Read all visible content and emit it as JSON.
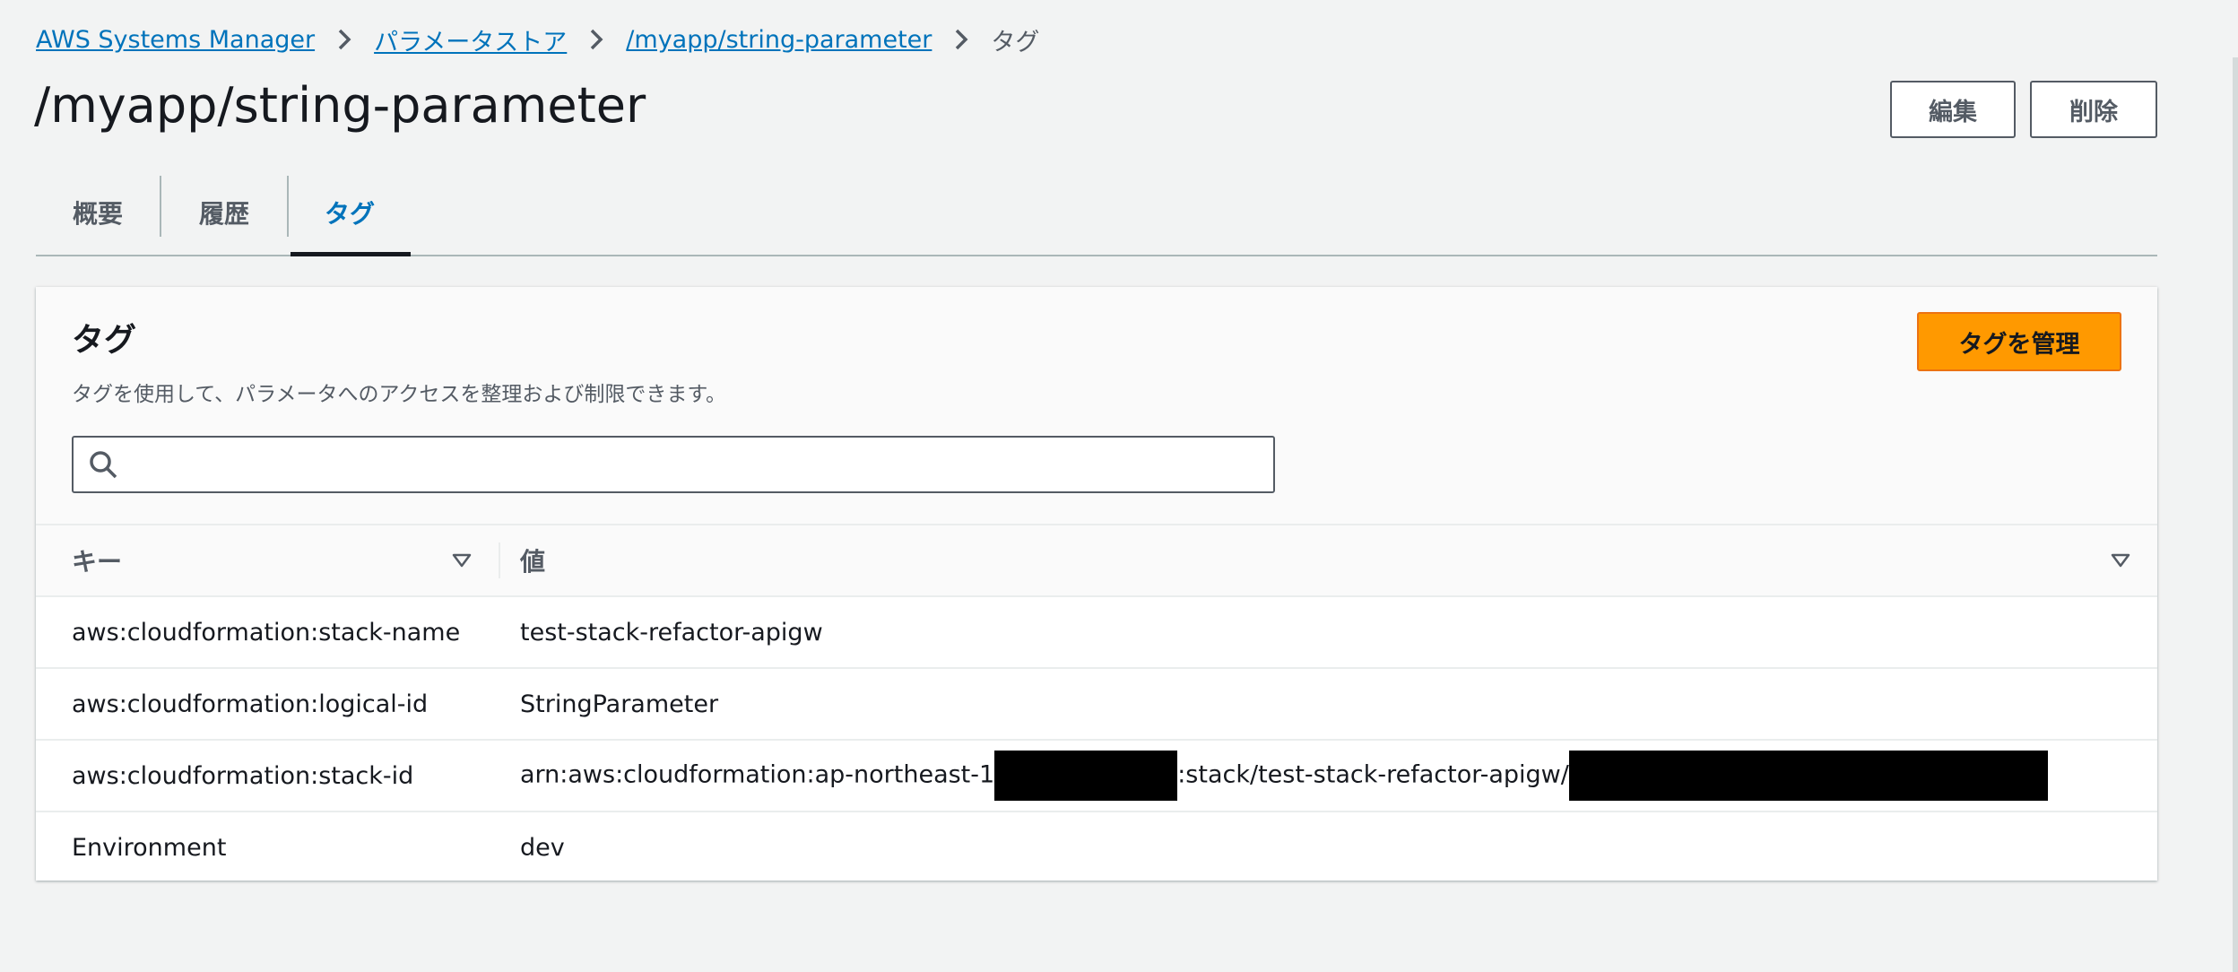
{
  "breadcrumb": {
    "items": [
      "AWS Systems Manager",
      "パラメータストア",
      "/myapp/string-parameter"
    ],
    "current": "タグ"
  },
  "page": {
    "title": "/myapp/string-parameter",
    "edit_label": "編集",
    "delete_label": "削除"
  },
  "tabs": [
    {
      "label": "概要",
      "active": false
    },
    {
      "label": "履歴",
      "active": false
    },
    {
      "label": "タグ",
      "active": true
    }
  ],
  "panel": {
    "title": "タグ",
    "description": "タグを使用して、パラメータへのアクセスを整理および制限できます。",
    "manage_button": "タグを管理",
    "search_placeholder": ""
  },
  "table": {
    "columns": [
      "キー",
      "値"
    ],
    "rows": [
      {
        "key": "aws:cloudformation:stack-name",
        "value": "test-stack-refactor-apigw"
      },
      {
        "key": "aws:cloudformation:logical-id",
        "value": "StringParameter"
      },
      {
        "key": "aws:cloudformation:stack-id",
        "value_parts": [
          "arn:aws:cloudformation:ap-northeast-1",
          ":stack/test-stack-refactor-apigw/"
        ]
      },
      {
        "key": "Environment",
        "value": "dev"
      }
    ]
  },
  "colors": {
    "link": "#0073bb",
    "primary": "#ff9900",
    "background": "#f2f3f3"
  },
  "icons": [
    "chevron-right-icon",
    "search-icon",
    "sort-triangle-icon"
  ]
}
